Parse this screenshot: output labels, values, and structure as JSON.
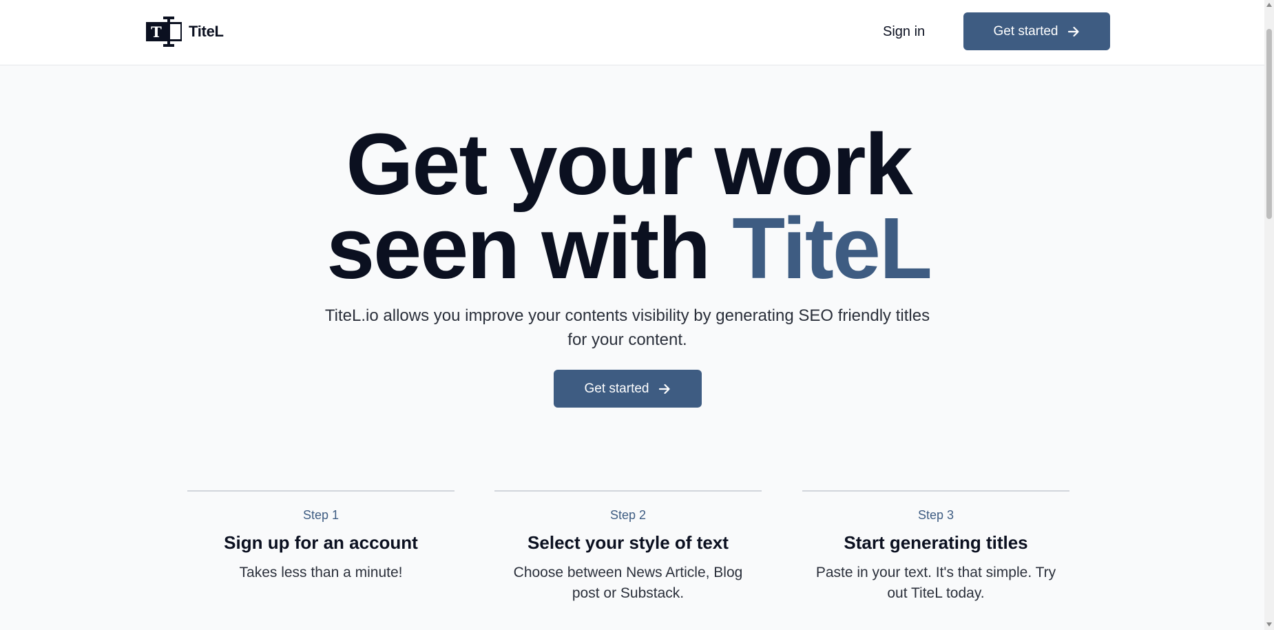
{
  "brand": {
    "name": "TiteL",
    "logo_glyph": "T"
  },
  "nav": {
    "signin_label": "Sign in",
    "cta_label": "Get started"
  },
  "hero": {
    "headline_line1": "Get your work",
    "headline_line2_prefix": "seen with ",
    "headline_line2_accent": "TiteL",
    "subtext": "TiteL.io allows you improve your contents visibility by generating SEO friendly titles for your content.",
    "cta_label": "Get started"
  },
  "steps": [
    {
      "label": "Step 1",
      "title": "Sign up for an account",
      "description": "Takes less than a minute!"
    },
    {
      "label": "Step 2",
      "title": "Select your style of text",
      "description": "Choose between News Article, Blog post or Substack."
    },
    {
      "label": "Step 3",
      "title": "Start generating titles",
      "description": "Paste in your text. It's that simple. Try out TiteL today."
    }
  ],
  "icons": {
    "cta_icon": "arrow-right-icon",
    "logo_icon": "text-cursor-logo-icon"
  },
  "colors": {
    "accent": "#3e5c82",
    "text": "#0b1020",
    "background": "#f9fafb",
    "header_bg": "#ffffff"
  }
}
